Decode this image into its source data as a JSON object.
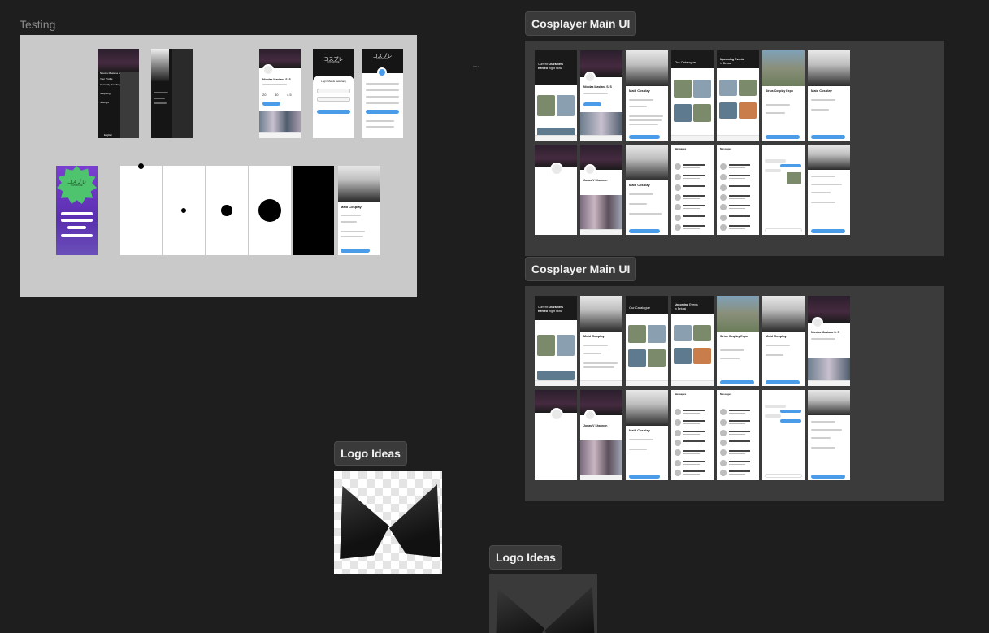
{
  "frames": {
    "testing": {
      "label": "Testing"
    },
    "main1": {
      "label": "Cosplayer Main UI"
    },
    "main2": {
      "label": "Cosplayer Main UI"
    },
    "logo1": {
      "label": "Logo Ideas"
    },
    "logo2": {
      "label": "Logo Ideas"
    }
  },
  "testing_screens": {
    "menu": {
      "name": "Nicolas Masiana S. S",
      "items": [
        "Your Profile",
        "Currently Trending",
        "Shopping",
        "Settings"
      ],
      "footer": "English"
    },
    "profile": {
      "name": "Nicolas Masiana S. S",
      "stats": [
        "20",
        "40",
        "4.5"
      ]
    },
    "login_title": "コスプレ",
    "login_subtitle": "KOSUPURE",
    "login_heading": "Login Masuk Sekarang",
    "signup_title": "コスプレ",
    "signup_subtitle": "KOSUPURE",
    "splash_title": "コスプレ",
    "splash_subtitle": "KOSUPURE",
    "product_title": "Maid Cosplay"
  },
  "main_screens": {
    "home_title_a": "Current",
    "home_title_b": "Characters",
    "home_title_c": "Rented",
    "home_title_d": "Right Now",
    "catalogue_title": "Our Catalogue",
    "events_title_a": "Upcoming",
    "events_title_b": "Events",
    "events_title_c": "in Bekasi",
    "event_name": "Sirius Cosplay Expo",
    "product_title": "Maid Cosplay",
    "profile_name": "Nicolas Masiana S. S",
    "profile2_name": "Jonas V Shannon",
    "messages_title": "Messages",
    "chat_title": "Messages"
  },
  "colors": {
    "canvas": "#1e1e1e",
    "frame_gray": "#c9c9c9",
    "frame_dark": "#3b3b3b",
    "accent": "#4a9be8"
  }
}
